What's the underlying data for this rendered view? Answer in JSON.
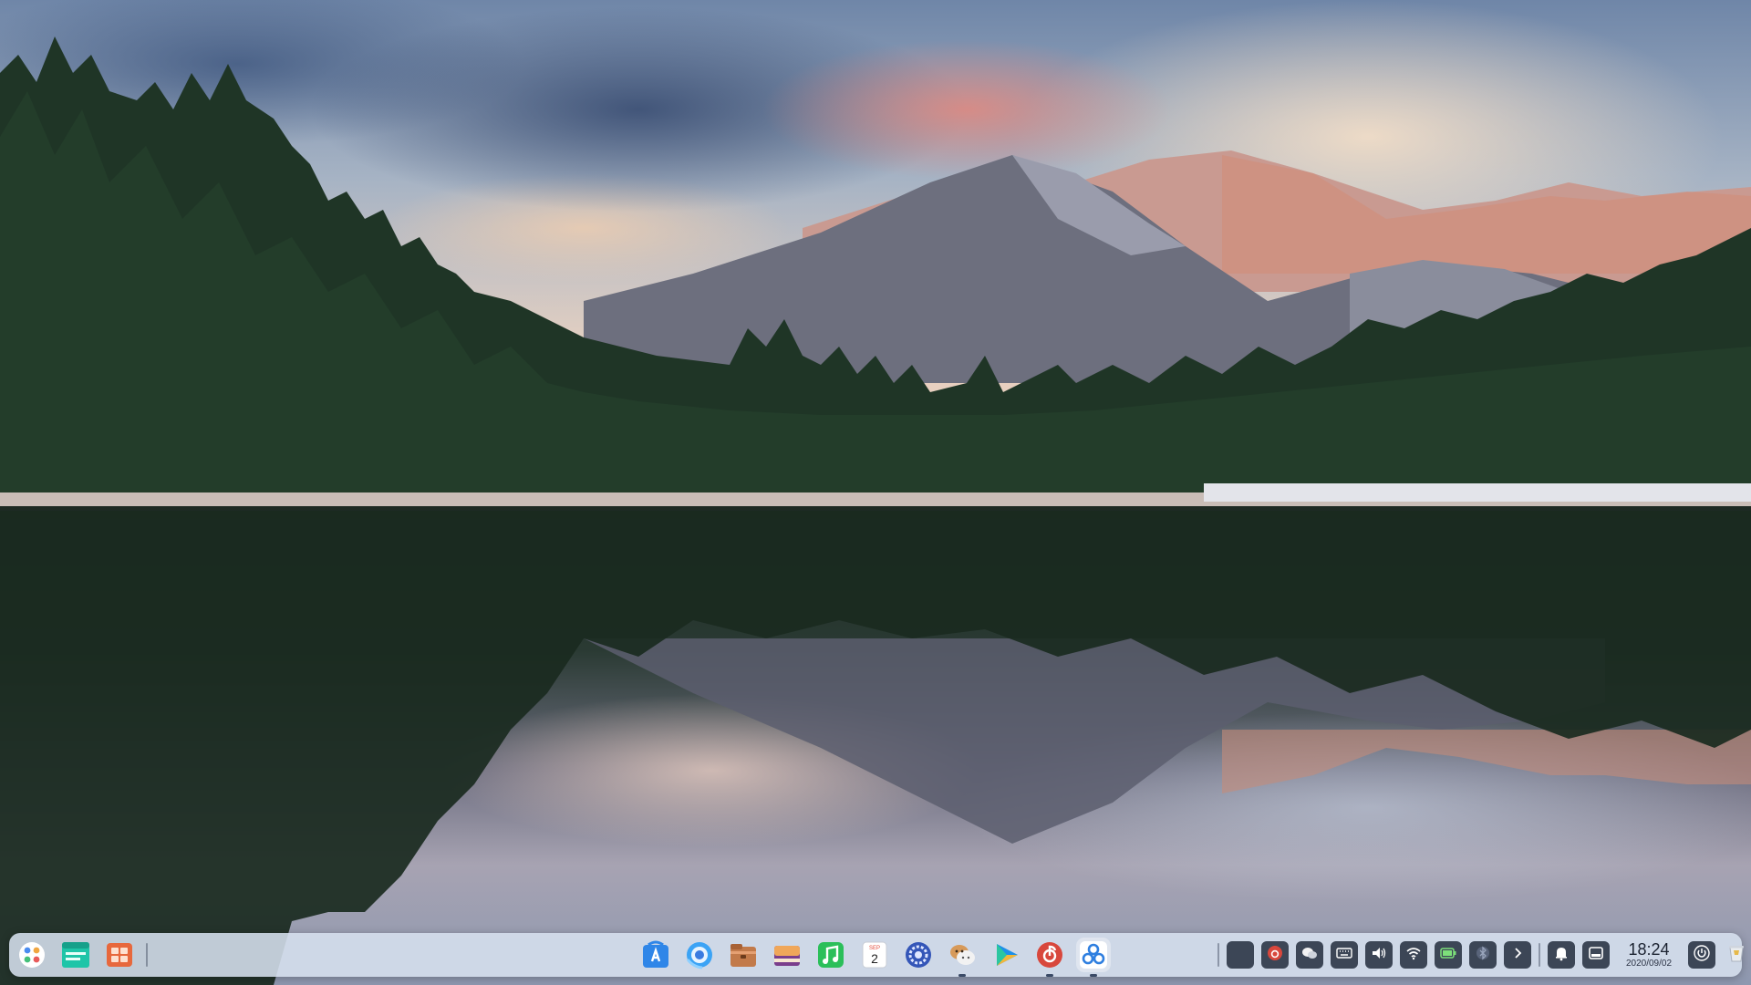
{
  "dock": {
    "left_apps": [
      {
        "name": "launcher-icon"
      },
      {
        "name": "multitasking-view-icon"
      },
      {
        "name": "show-desktop-icon"
      }
    ],
    "center_apps": [
      {
        "name": "app-store-icon"
      },
      {
        "name": "browser-icon"
      },
      {
        "name": "file-manager-icon"
      },
      {
        "name": "image-viewer-icon"
      },
      {
        "name": "music-icon"
      },
      {
        "name": "calendar-icon"
      },
      {
        "name": "settings-icon"
      },
      {
        "name": "wechat-icon"
      },
      {
        "name": "video-player-icon"
      },
      {
        "name": "netease-music-icon"
      },
      {
        "name": "control-center-icon"
      }
    ],
    "calendar": {
      "month": "SEP",
      "day": "2"
    },
    "tray_items": [
      {
        "name": "tray-app-icon"
      },
      {
        "name": "tray-netease-icon"
      },
      {
        "name": "tray-wechat-icon"
      },
      {
        "name": "keyboard-icon"
      },
      {
        "name": "volume-icon"
      },
      {
        "name": "wifi-icon"
      },
      {
        "name": "battery-icon"
      },
      {
        "name": "bluetooth-icon"
      },
      {
        "name": "expand-tray-icon"
      }
    ],
    "clock": {
      "time": "18:24",
      "date": "2020/09/02"
    },
    "right_items": [
      {
        "name": "notification-bell-icon"
      },
      {
        "name": "notification-center-icon"
      },
      {
        "name": "power-icon"
      },
      {
        "name": "trash-icon"
      }
    ]
  }
}
